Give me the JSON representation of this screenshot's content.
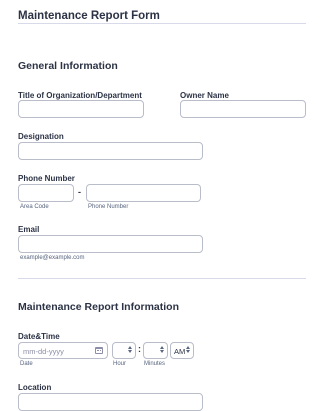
{
  "form": {
    "title": "Maintenance Report Form"
  },
  "general": {
    "heading": "General Information",
    "organization": {
      "label": "Title of Organization/Department",
      "value": ""
    },
    "owner": {
      "label": "Owner Name",
      "value": ""
    },
    "designation": {
      "label": "Designation",
      "value": ""
    },
    "phone": {
      "label": "Phone Number",
      "separator": "-",
      "area_sublabel": "Area Code",
      "number_sublabel": "Phone Number"
    },
    "email": {
      "label": "Email",
      "sublabel": "example@example.com"
    }
  },
  "report": {
    "heading": "Maintenance Report Information",
    "datetime": {
      "label": "Date&Time",
      "date_placeholder": "mm-dd-yyyy",
      "date_sublabel": "Date",
      "hour_sublabel": "Hour",
      "minutes_sublabel": "Minutes",
      "time_separator": ":",
      "ampm": "AM"
    },
    "location": {
      "label": "Location"
    }
  },
  "icons": {
    "date": "calendar-icon",
    "spinner": "spinner-arrows-icon"
  }
}
